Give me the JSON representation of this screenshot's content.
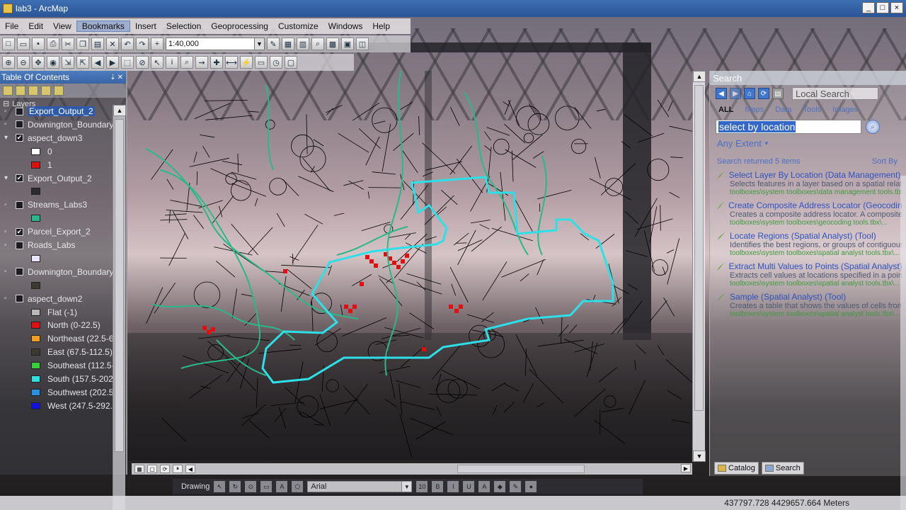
{
  "window": {
    "title": "lab3 - ArcMap",
    "controls": [
      "_",
      "□",
      "×"
    ]
  },
  "menu": [
    "File",
    "Edit",
    "View",
    "Bookmarks",
    "Insert",
    "Selection",
    "Geoprocessing",
    "Customize",
    "Windows",
    "Help"
  ],
  "toolbar": {
    "scale": "1:40,000"
  },
  "toc": {
    "title": "Table Of Contents",
    "layers_label": "Layers",
    "rows": [
      {
        "type": "layer",
        "label": "Export_Output_2",
        "selected": true,
        "checked": false
      },
      {
        "type": "layer",
        "label": "Downington_Boundary",
        "checked": false
      },
      {
        "type": "layer",
        "label": "aspect_down3",
        "checked": true,
        "expanded": true
      },
      {
        "type": "legend",
        "label": "0",
        "color": "#ffffff"
      },
      {
        "type": "legend",
        "label": "1",
        "color": "#e01010"
      },
      {
        "type": "layer",
        "label": "Export_Output_2",
        "checked": true,
        "expanded": true
      },
      {
        "type": "legend",
        "label": "",
        "color": "#2a2a30"
      },
      {
        "type": "layer",
        "label": "Streams_Labs3",
        "checked": false
      },
      {
        "type": "legend",
        "label": "",
        "color": "#2ab88a"
      },
      {
        "type": "layer",
        "label": "Parcel_Export_2",
        "checked": true
      },
      {
        "type": "layer",
        "label": "Roads_Labs",
        "checked": false
      },
      {
        "type": "legend",
        "label": "",
        "color": "#e8e4ff"
      },
      {
        "type": "layer",
        "label": "Downington_Boundary",
        "checked": false
      },
      {
        "type": "legend",
        "label": "",
        "color": "#3a3a30"
      },
      {
        "type": "layer",
        "label": "aspect_down2",
        "checked": false
      },
      {
        "type": "legend",
        "label": "Flat (-1)",
        "color": "#b8b8b8"
      },
      {
        "type": "legend",
        "label": "North (0-22.5)",
        "color": "#e01010"
      },
      {
        "type": "legend",
        "label": "Northeast (22.5-67.5)",
        "color": "#f0a020"
      },
      {
        "type": "legend",
        "label": "East (67.5-112.5)",
        "color": "#3a3a30"
      },
      {
        "type": "legend",
        "label": "Southeast (112.5-157.5)",
        "color": "#38d038"
      },
      {
        "type": "legend",
        "label": "South (157.5-202.5)",
        "color": "#30e0e0"
      },
      {
        "type": "legend",
        "label": "Southwest (202.5-247.5)",
        "color": "#2a90e0"
      },
      {
        "type": "legend",
        "label": "West (247.5-292.5)",
        "color": "#1010e0"
      }
    ]
  },
  "search": {
    "title": "Search",
    "local_search": "Local Search",
    "categories": [
      "ALL",
      "Maps",
      "Data",
      "Tools",
      "Images"
    ],
    "query": "select by location",
    "extent": "Any Extent",
    "results_count": "Search returned 5 items",
    "sort": "Sort By",
    "results": [
      {
        "title": "Select Layer By Location (Data Management) (Tool)",
        "desc": "Selects features in a layer based on a spatial relationship...",
        "path": "toolboxes\\system toolboxes\\data management tools.tbx\\..."
      },
      {
        "title": "Create Composite Address Locator (Geocoding) (Tool)",
        "desc": "Creates a composite address locator. A composite...",
        "path": "toolboxes\\system toolboxes\\geocoding tools.tbx\\..."
      },
      {
        "title": "Locate Regions (Spatial Analyst) (Tool)",
        "desc": "Identifies the best regions, or groups of contiguous...",
        "path": "toolboxes\\system toolboxes\\spatial analyst tools.tbx\\..."
      },
      {
        "title": "Extract Multi Values to Points (Spatial Analyst) (Tool)",
        "desc": "Extracts cell values at locations specified in a point...",
        "path": "toolboxes\\system toolboxes\\spatial analyst tools.tbx\\..."
      },
      {
        "title": "Sample (Spatial Analyst) (Tool)",
        "desc": "Creates a table that shows the values of cells from...",
        "path": "toolboxes\\system toolboxes\\spatial analyst tools.tbx\\..."
      }
    ],
    "tabs": [
      "Catalog",
      "Search"
    ]
  },
  "drawbar": {
    "drawing": "Drawing",
    "font": "Arial"
  },
  "status": {
    "coords": "437797.728  4429657.664 Meters"
  },
  "colors": {
    "boundary": "#2de0e8",
    "streams": "#2ab88a",
    "aspect_north": "#e01010",
    "parcels": "#000000"
  }
}
